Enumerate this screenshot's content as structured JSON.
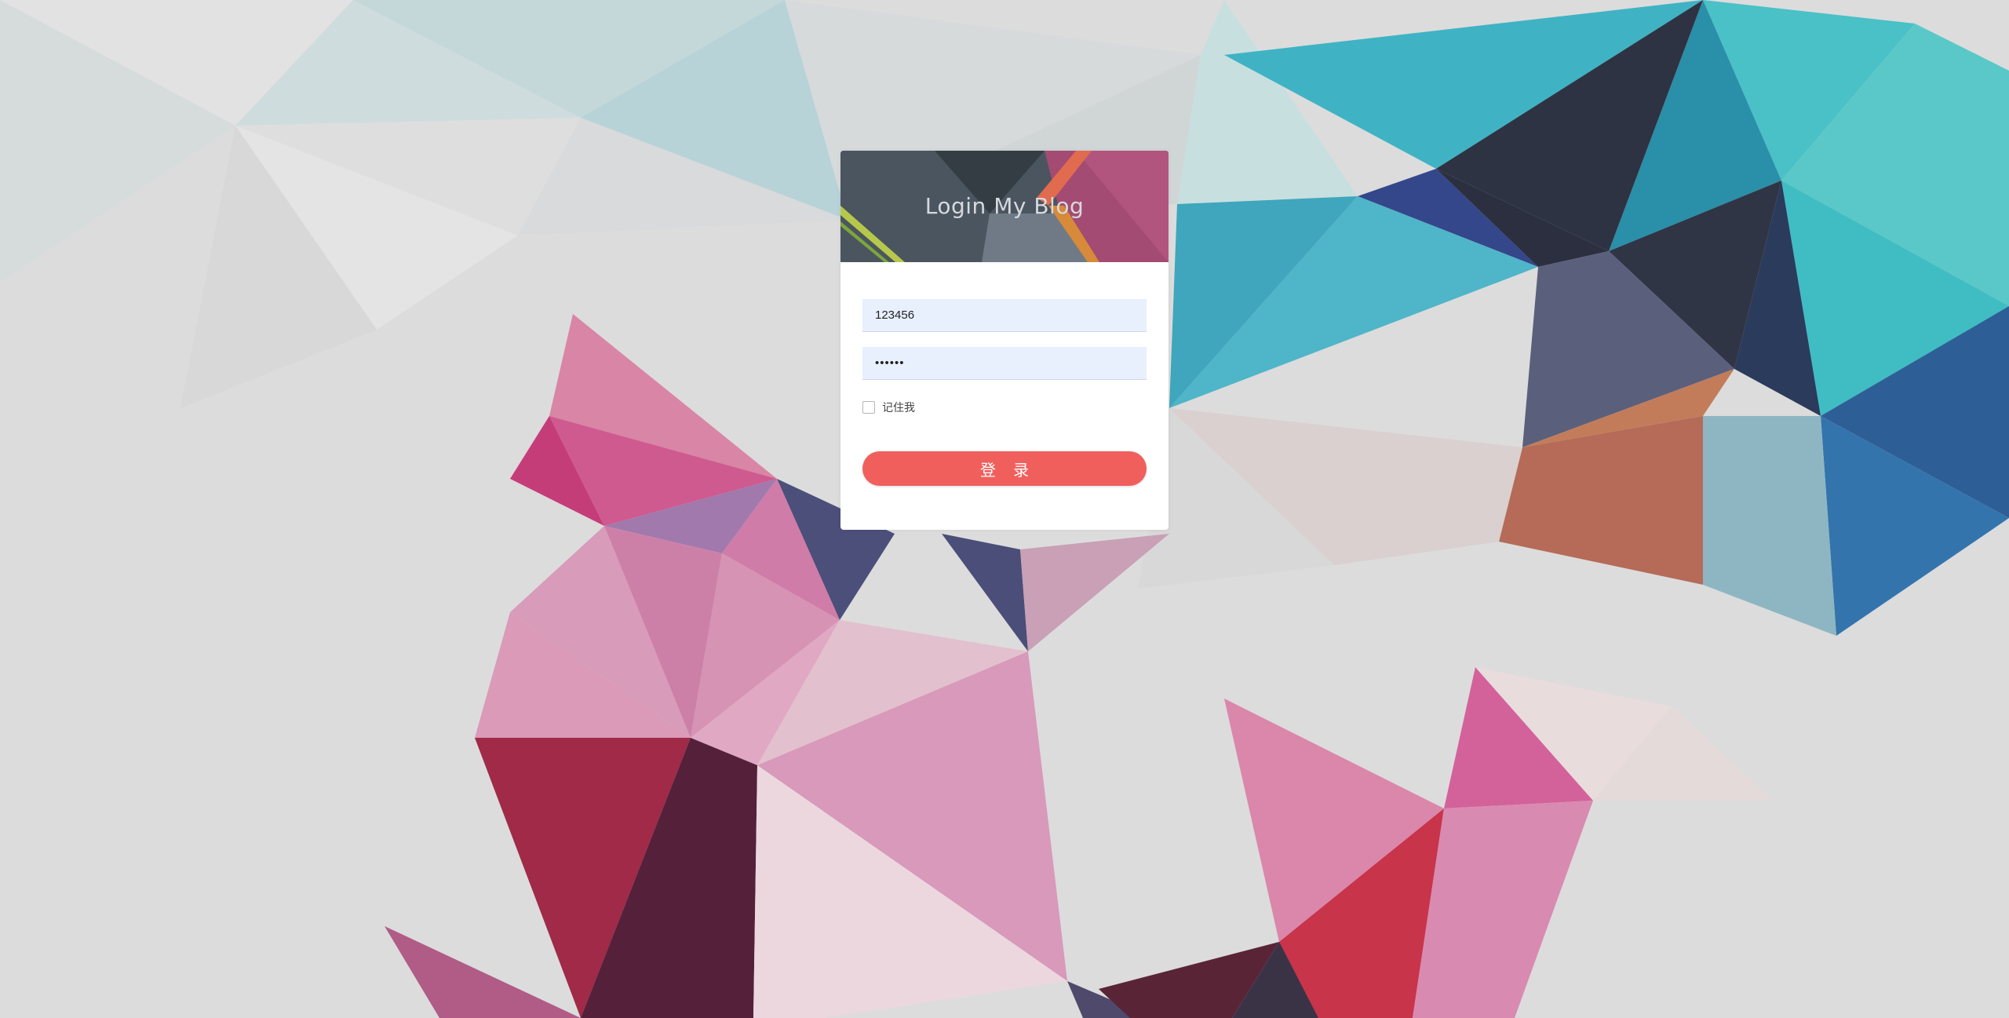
{
  "login": {
    "title": "Login My Blog",
    "username_value": "123456",
    "password_value": "••••••",
    "remember_label": "记住我",
    "submit_label": "登 录"
  },
  "colors": {
    "accent_button": "#f05f5c",
    "input_bg": "#e8f0fe",
    "header_bg": "#4b555f"
  },
  "icons": [
    "checkbox-icon"
  ]
}
